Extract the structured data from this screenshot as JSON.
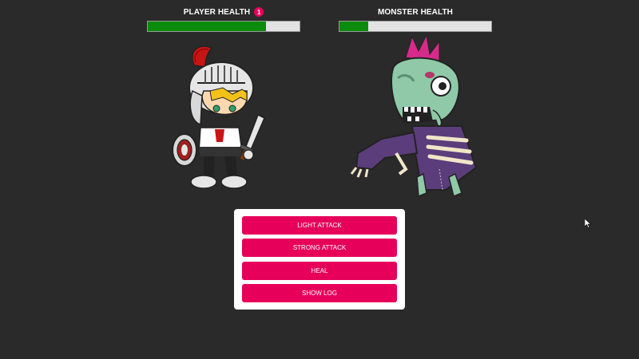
{
  "player": {
    "label": "PLAYER HEALTH",
    "level_badge": "1",
    "health_fraction": 0.78
  },
  "monster": {
    "label": "MONSTER HEALTH",
    "health_fraction": 0.19
  },
  "actions": {
    "light_attack": "LIGHT ATTACK",
    "strong_attack": "STRONG ATTACK",
    "heal": "HEAL",
    "show_log": "SHOW LOG"
  },
  "colors": {
    "background": "#2b2a2b",
    "health_fill": "#0b8b0b",
    "health_empty": "#e3e3e3",
    "accent": "#e6005a",
    "panel": "#ffffff"
  },
  "icons": {
    "player_sprite": "knight-icon",
    "monster_sprite": "zombie-icon",
    "pointer": "cursor-icon"
  }
}
